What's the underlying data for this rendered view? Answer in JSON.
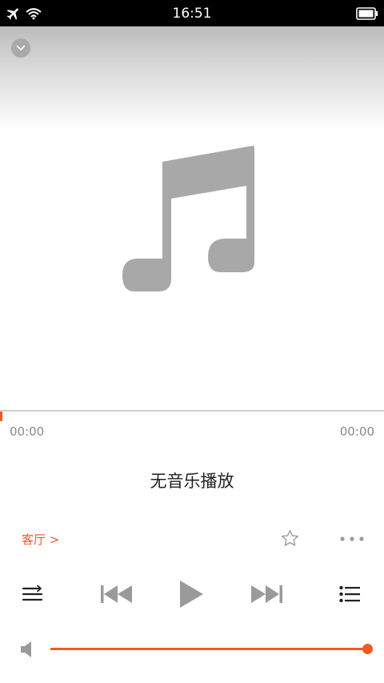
{
  "status_bar": {
    "time": "16:51",
    "icons": [
      "airplane-icon",
      "wifi-icon",
      "battery-icon"
    ]
  },
  "player": {
    "collapse_icon": "chevron-down-icon",
    "album_art_icon": "music-note-icon",
    "progress": 0,
    "elapsed_time": "00:00",
    "total_time": "00:00",
    "song_title": "无音乐播放",
    "device_link": "客厅 >",
    "favorite_icon": "star-outline-icon",
    "more_icon": "more-dots-icon",
    "controls": [
      "repeat-icon",
      "previous-track-icon",
      "play-icon",
      "next-track-icon",
      "playlist-icon"
    ],
    "volume_icon": "speaker-icon",
    "volume": 1.0
  },
  "colors": {
    "accent": "#f15a22",
    "icon_gray": "#9a9a9a",
    "control_dark": "#222222",
    "status_bar_bg": "#000000"
  }
}
